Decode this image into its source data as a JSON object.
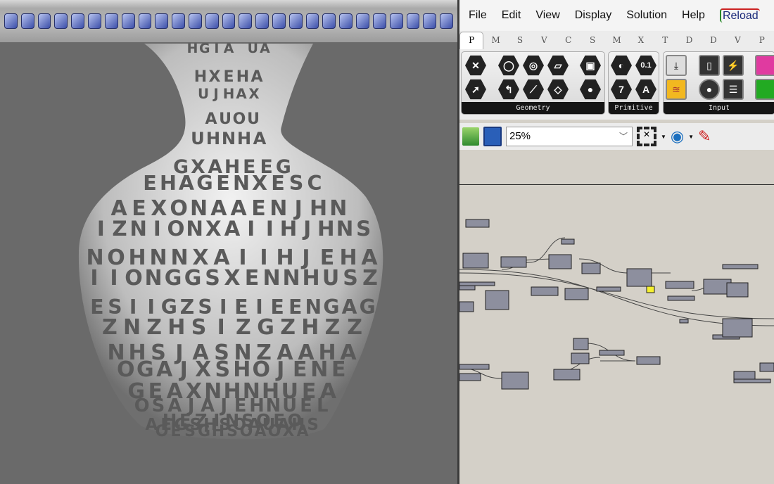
{
  "menu": {
    "items": [
      "File",
      "Edit",
      "View",
      "Display",
      "Solution",
      "Help"
    ],
    "reload": "Reload"
  },
  "tabs": [
    "P",
    "M",
    "S",
    "V",
    "C",
    "S",
    "M",
    "X",
    "T",
    "D",
    "D",
    "V",
    "P"
  ],
  "ribbon": {
    "groups": [
      {
        "label": "Geometry"
      },
      {
        "label": "Primitive"
      },
      {
        "label": "Input"
      }
    ]
  },
  "primitive_icons": [
    "0.1",
    "7",
    "A"
  ],
  "toolbar": {
    "zoom_value": "25%"
  },
  "vase_letters": [
    "HGIA UA",
    "HXEHA",
    "UJHAX",
    "AUOU",
    "UHNHA",
    "GXAHEEG",
    "EHAGENXESC",
    "AEXONAAENJHN",
    "IZNIONXAIIHJHNS",
    "NOHNNXAIIHJEHA",
    "IIONGGSXENNHUSZ",
    "ESIIGZSIEIEENGAG",
    "ZNZHSIZGZHZZ",
    "NHSJASNZAAHA",
    "OGAJXSHOJENE",
    "GEAXNHNHUEA",
    "OSAJAJEHNUEL",
    "AEGSHSOAUAHS",
    "OESGHSOAOXA",
    "HEZINSOEO"
  ]
}
